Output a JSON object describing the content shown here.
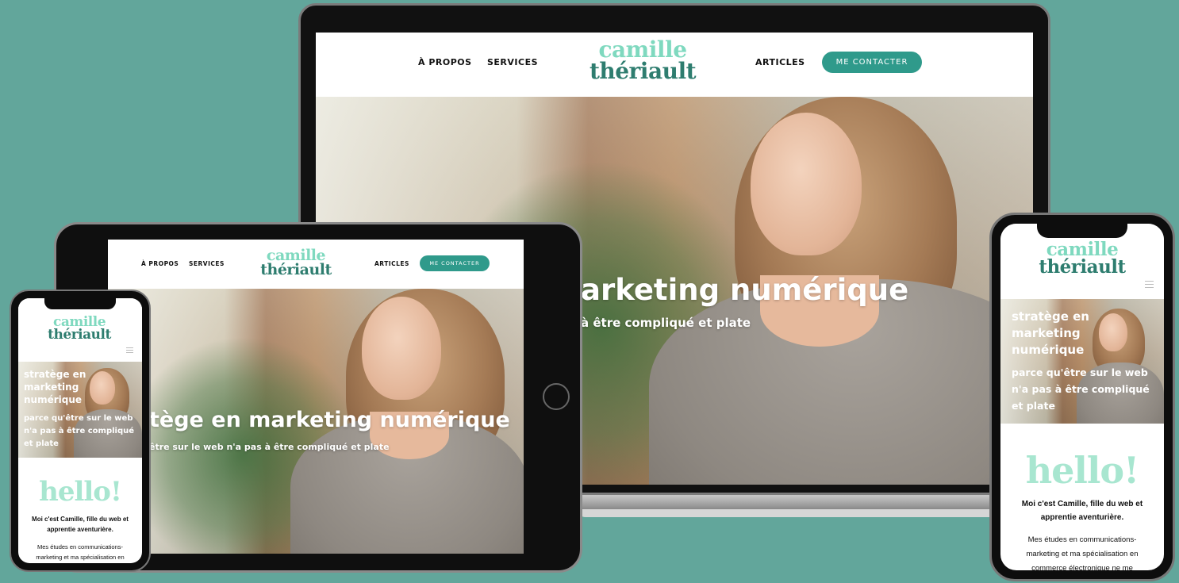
{
  "site": {
    "logo_line1": "camille",
    "logo_line2": "thériault"
  },
  "nav": {
    "about": "À PROPOS",
    "services": "SERVICES",
    "articles": "ARTICLES",
    "contact": "ME CONTACTER"
  },
  "hero": {
    "laptop_title": "arketing numérique",
    "laptop_subtitle": "à être compliqué et plate",
    "tablet_title": "tège en marketing numérique",
    "tablet_subtitle": "être sur le web n'a pas à être compliqué et plate",
    "mobile_title_lines": [
      "stratège en",
      "marketing",
      "numérique"
    ],
    "mobile_subtitle_lines": [
      "parce qu'être sur le web",
      "n'a pas à être compliqué",
      "et plate"
    ]
  },
  "about": {
    "greeting": "hello!",
    "intro_lines": [
      "Moi c'est Camille, fille du web et",
      "apprentie aventurière."
    ],
    "body_lines_left": [
      "Mes études en communications-",
      "marketing et ma spécialisation en"
    ],
    "body_lines_right": [
      "Mes études en communications-",
      "marketing et ma spécialisation en",
      "commerce électronique ne me"
    ]
  },
  "icons": {
    "menu": "hamburger-menu-icon",
    "home_button": "home-button-icon"
  },
  "colors": {
    "background": "#62a69b",
    "logo_light": "#7fd9bf",
    "logo_dark": "#2e7d6f",
    "cta": "#2f9a8b",
    "hello": "#a8e6d0"
  }
}
